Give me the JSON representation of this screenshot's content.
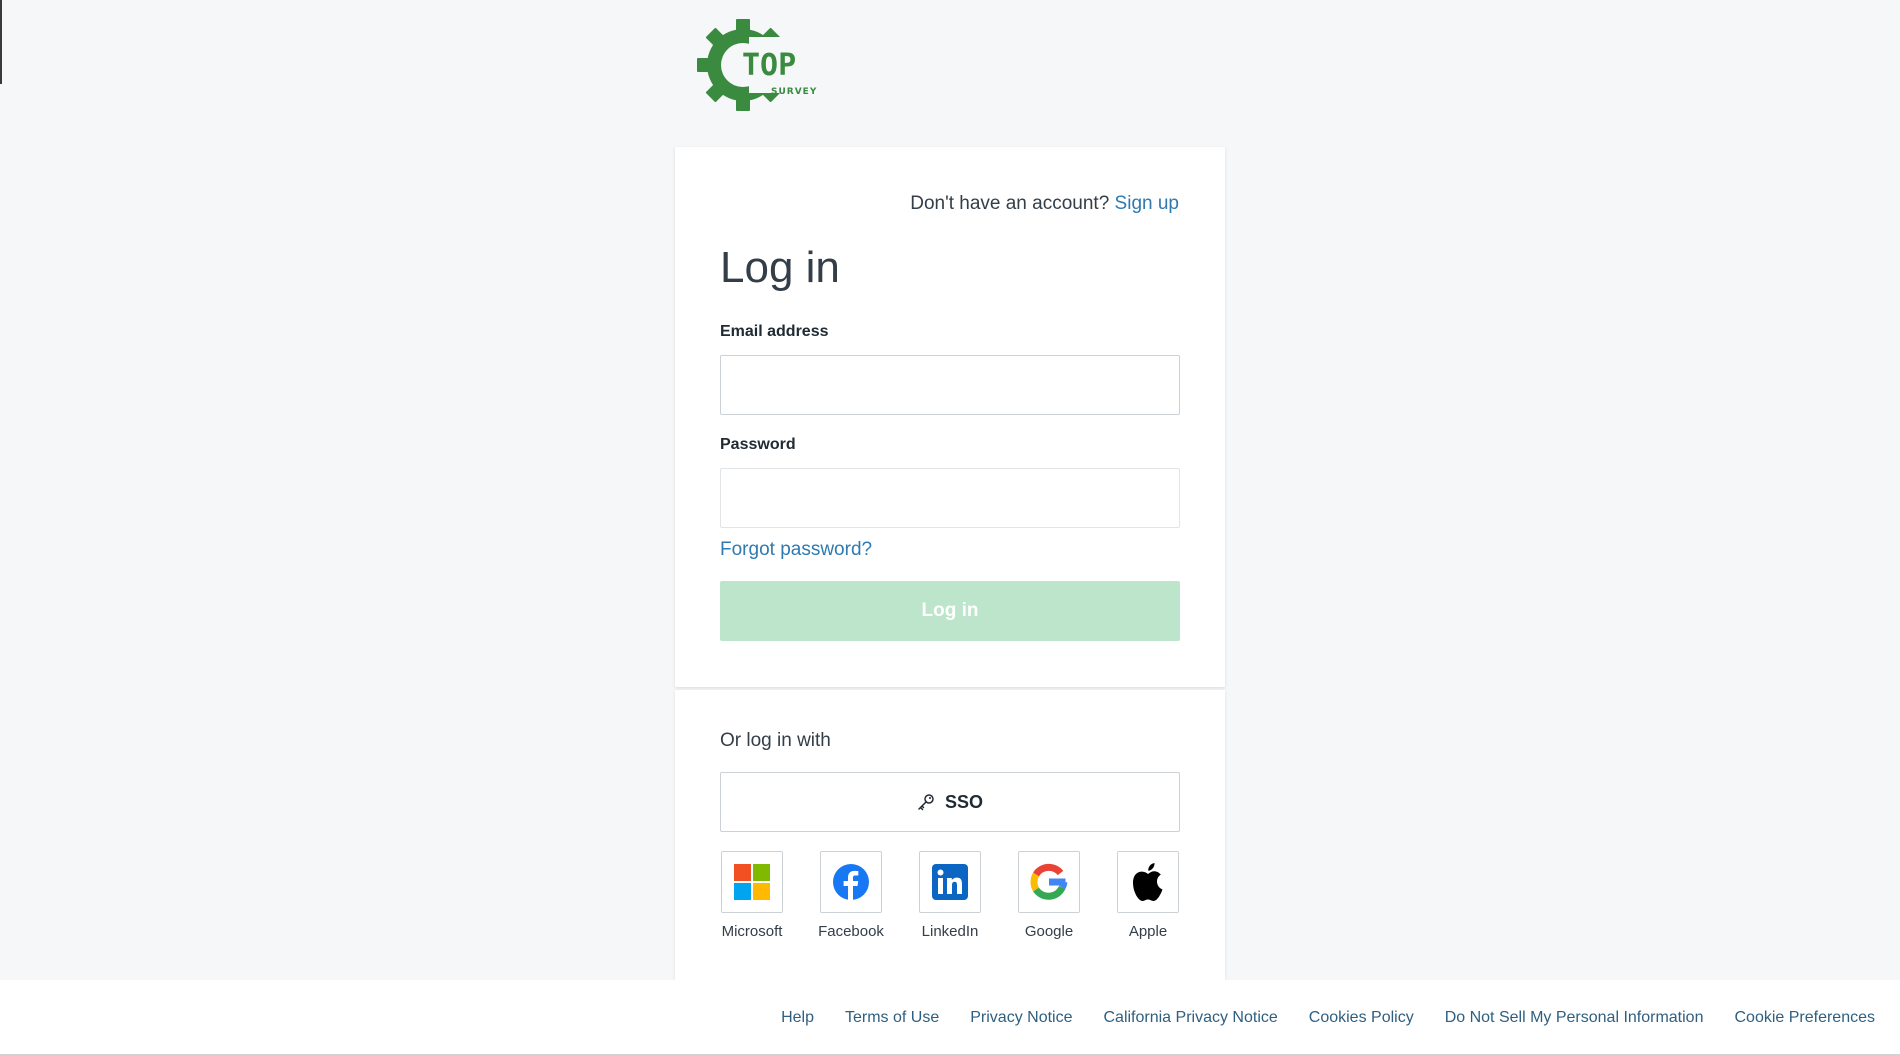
{
  "brand": {
    "logo_text": "TOP",
    "logo_subtext": "SURVEY",
    "color": "#3a8a3f"
  },
  "login": {
    "signup_prompt": "Don't have an account?",
    "signup_link": "Sign up",
    "title": "Log in",
    "email_label": "Email address",
    "email_value": "",
    "password_label": "Password",
    "password_value": "",
    "forgot_link": "Forgot password?",
    "submit_label": "Log in",
    "submit_color": "#bde5cb"
  },
  "alt_login": {
    "heading": "Or log in with",
    "sso_label": "SSO",
    "sso_icon": "key-icon",
    "providers": [
      {
        "label": "Microsoft",
        "icon": "microsoft-icon"
      },
      {
        "label": "Facebook",
        "icon": "facebook-icon"
      },
      {
        "label": "LinkedIn",
        "icon": "linkedin-icon"
      },
      {
        "label": "Google",
        "icon": "google-icon"
      },
      {
        "label": "Apple",
        "icon": "apple-icon"
      }
    ]
  },
  "footer": {
    "links": [
      "Help",
      "Terms of Use",
      "Privacy Notice",
      "California Privacy Notice",
      "Cookies Policy",
      "Do Not Sell My Personal Information",
      "Cookie Preferences"
    ]
  },
  "colors": {
    "link": "#2f7ab0",
    "footer_link": "#2f5f80",
    "background": "#f6f7f9"
  }
}
